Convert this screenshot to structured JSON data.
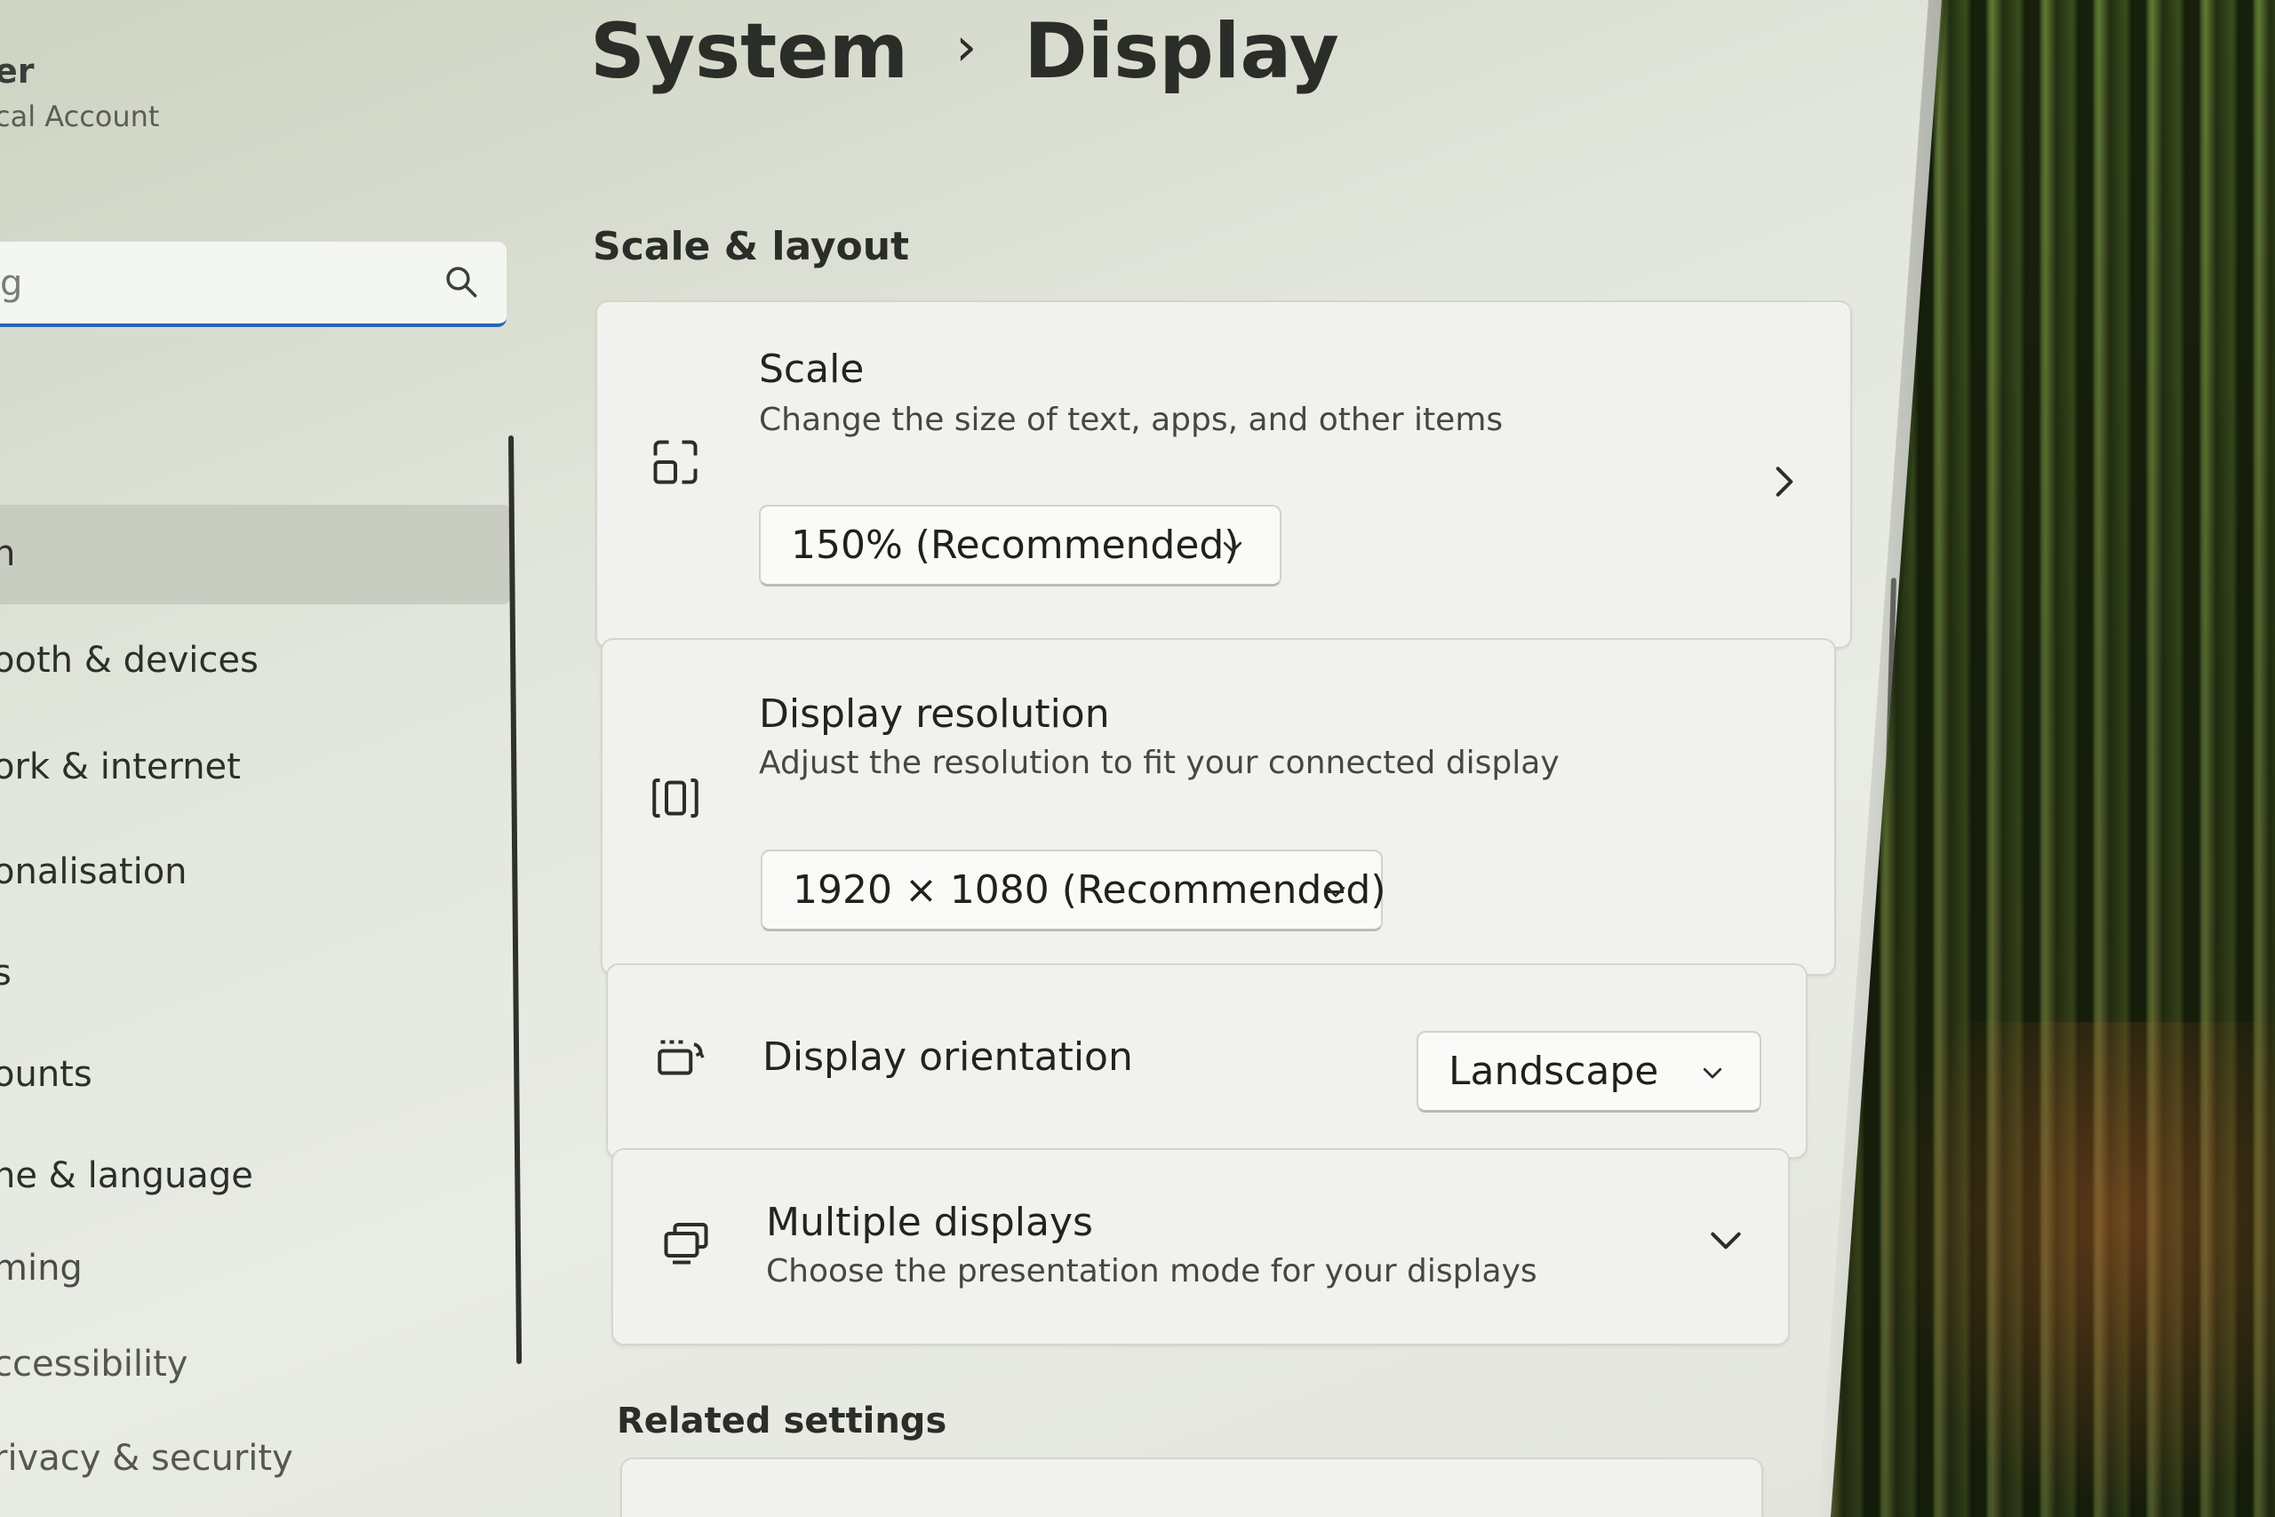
{
  "sidebar": {
    "user_name": "er",
    "user_account": "cal Account",
    "search": {
      "value": "g"
    },
    "items": [
      {
        "label": "n",
        "selected": true
      },
      {
        "label": "ooth & devices"
      },
      {
        "label": "ork & internet"
      },
      {
        "label": "onalisation"
      },
      {
        "label": "s"
      },
      {
        "label": "ounts"
      },
      {
        "label": "ne & language"
      },
      {
        "label": "ming"
      },
      {
        "label": "ccessibility"
      },
      {
        "label": "rivacy & security"
      }
    ]
  },
  "header": {
    "breadcrumb_parent": "System",
    "breadcrumb_separator": "›",
    "breadcrumb_current": "Display"
  },
  "scale_layout": {
    "section_title": "Scale & layout",
    "scale": {
      "icon": "scale-icon",
      "title": "Scale",
      "description": "Change the size of text, apps, and other items",
      "value": "150% (Recommended)"
    },
    "resolution": {
      "icon": "resolution-icon",
      "title": "Display resolution",
      "description": "Adjust the resolution to fit your connected display",
      "value": "1920 × 1080 (Recommended)"
    },
    "orientation": {
      "icon": "orientation-icon",
      "title": "Display orientation",
      "value": "Landscape"
    },
    "multiple_displays": {
      "icon": "multiple-displays-icon",
      "title": "Multiple displays",
      "description": "Choose the presentation mode for your displays"
    }
  },
  "related": {
    "section_title": "Related settings"
  },
  "colors": {
    "accent": "#2a63b8",
    "card_bg": "#f1f2ee",
    "text": "#22241f"
  }
}
